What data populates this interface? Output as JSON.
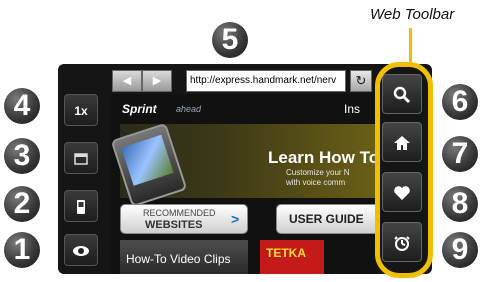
{
  "callout": {
    "toolbar_label": "Web Toolbar"
  },
  "badges": {
    "b1": "1",
    "b2": "2",
    "b3": "3",
    "b4": "4",
    "b5": "5",
    "b6": "6",
    "b7": "7",
    "b8": "8",
    "b9": "9"
  },
  "left_controls": {
    "zoom_label": "1x"
  },
  "nav": {
    "back_icon": "◀",
    "forward_icon": "▶",
    "url": "http://express.handmark.net/nerv",
    "reload_icon": "↻"
  },
  "page": {
    "brand": "Sprint",
    "brand_tag": "ahead",
    "header_right": "Ins",
    "banner_title": "Learn How To",
    "banner_sub1": "Customize your N",
    "banner_sub2": "with voice comm",
    "rec_line1": "RECOMMENDED",
    "rec_line2": "WEBSITES",
    "rec_arrow": ">",
    "user_guide": "USER GUIDE",
    "howto": "How-To Video Clips",
    "tetka": "TETKA"
  },
  "toolbar": {
    "search_icon": "🔍",
    "home_icon": "🏠",
    "favorites_icon": "♥",
    "history_icon": "⏱"
  }
}
